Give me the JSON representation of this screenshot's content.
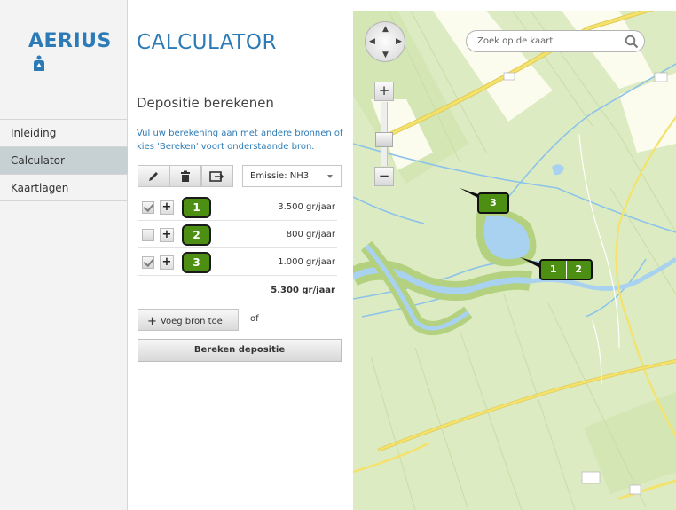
{
  "logo": {
    "text": "AERIUS"
  },
  "nav": [
    {
      "label": "Inleiding"
    },
    {
      "label": "Calculator"
    },
    {
      "label": "Kaartlagen"
    }
  ],
  "panel": {
    "app_title": "CALCULATOR",
    "section_title": "Depositie berekenen",
    "intro": "Vul uw berekening aan met andere bronnen of kies 'Bereken' voort onderstaande bron.",
    "emission_select": "Emissie: NH3",
    "sources": [
      {
        "id": "1",
        "checked": true,
        "value": "3.500 gr/jaar"
      },
      {
        "id": "2",
        "checked": false,
        "value": "800 gr/jaar"
      },
      {
        "id": "3",
        "checked": true,
        "value": "1.000 gr/jaar"
      }
    ],
    "total": "5.300 gr/jaar",
    "add_button": "Voeg bron toe",
    "or_text": "of",
    "calculate_button": "Bereken depositie"
  },
  "map": {
    "search_placeholder": "Zoek op de kaart",
    "zoom_in": "+",
    "zoom_out": "−",
    "markers": [
      {
        "labels": [
          "3"
        ]
      },
      {
        "labels": [
          "1",
          "2"
        ]
      }
    ]
  },
  "colors": {
    "brand": "#2c7bb6",
    "badge": "#4c8f12",
    "nav_active": "#c7d1d4",
    "map_land": "#dcebc2",
    "map_water": "#a9d2f0",
    "map_road": "#f4e26b"
  }
}
